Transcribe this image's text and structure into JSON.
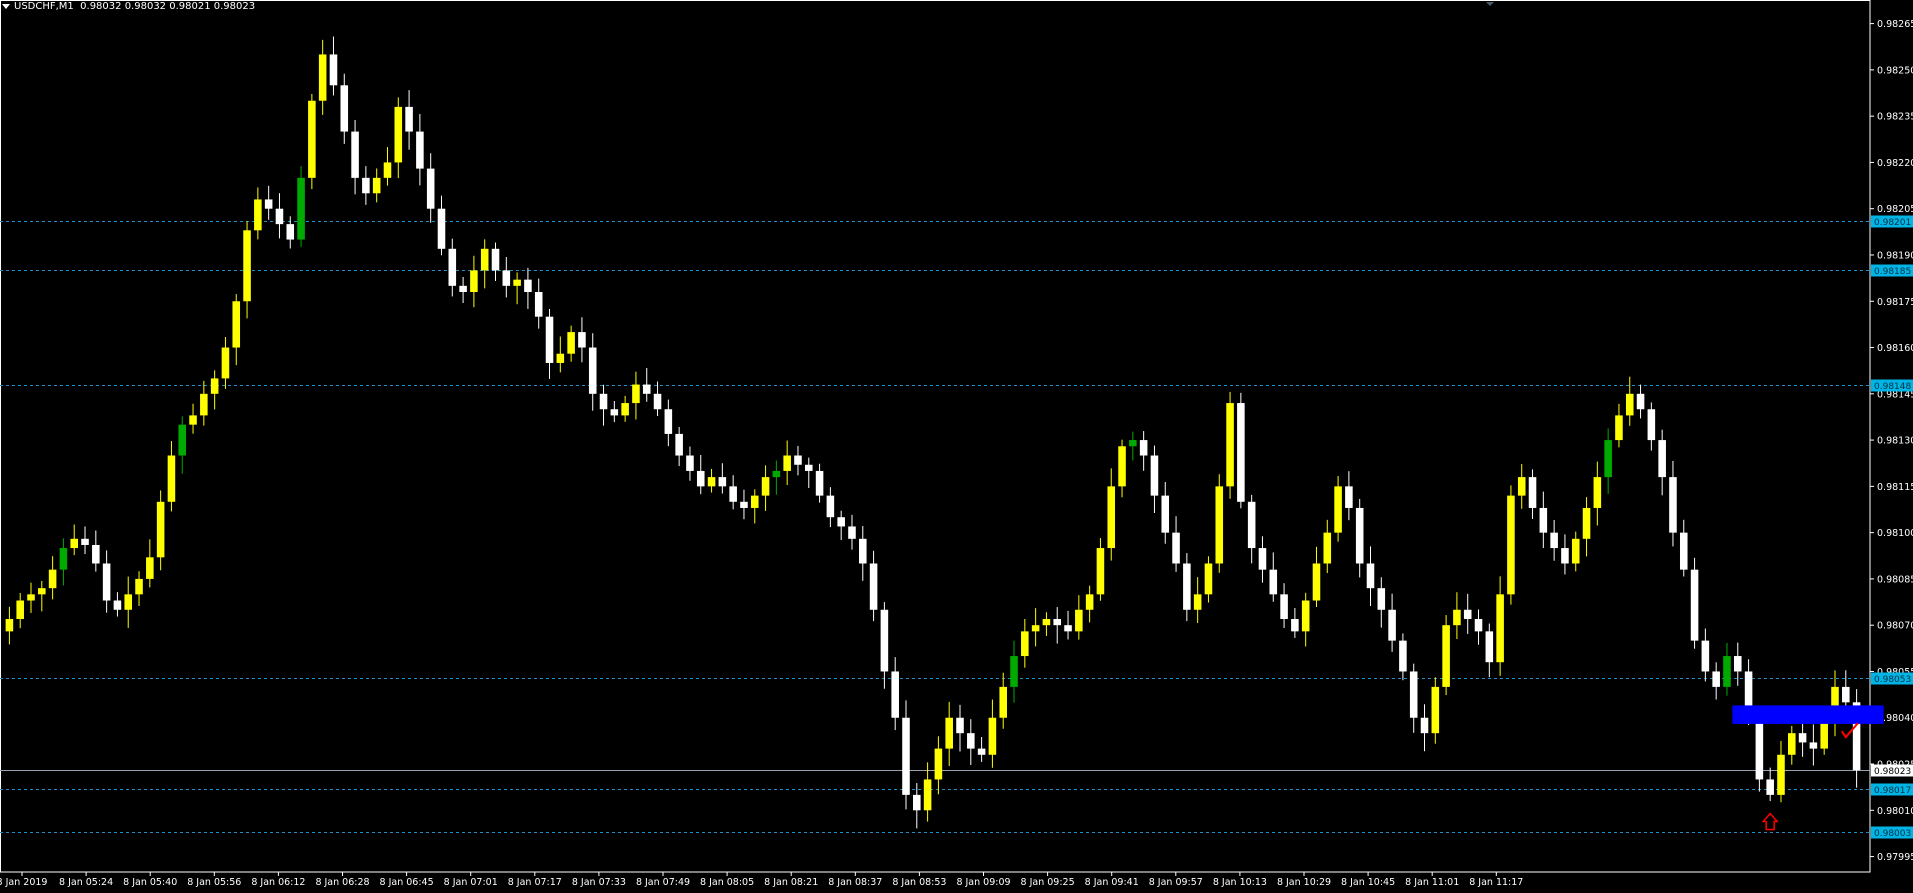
{
  "header": {
    "symbol": "USDCHF,M1",
    "ohlc": "0.98032 0.98032 0.98021 0.98023"
  },
  "colors": {
    "background": "#000000",
    "axis": "#ffffff",
    "bull_candle": "#ffff00",
    "bull_alt_candle": "#00aa00",
    "bear_candle": "#ffffff",
    "hline": "#1e90c8",
    "hline_label_bg": "#00b4e6",
    "zone": "#0000ff",
    "arrow": "#ff0000",
    "check": "#ff0000"
  },
  "chart_data": {
    "type": "candlestick",
    "ylim": [
      0.9799,
      0.98272
    ],
    "y_ticks": [
      "0.98265",
      "0.98250",
      "0.98235",
      "0.98220",
      "0.98205",
      "0.98190",
      "0.98175",
      "0.98160",
      "0.98145",
      "0.98130",
      "0.98115",
      "0.98100",
      "0.98085",
      "0.98070",
      "0.98055",
      "0.98040",
      "0.98025",
      "0.98010",
      "0.97995"
    ],
    "x_tick_labels": [
      "8 Jan 2019",
      "8 Jan 05:24",
      "8 Jan 05:40",
      "8 Jan 05:56",
      "8 Jan 06:12",
      "8 Jan 06:28",
      "8 Jan 06:45",
      "8 Jan 07:01",
      "8 Jan 07:17",
      "8 Jan 07:33",
      "8 Jan 07:49",
      "8 Jan 08:05",
      "8 Jan 08:21",
      "8 Jan 08:37",
      "8 Jan 08:53",
      "8 Jan 09:09",
      "8 Jan 09:25",
      "8 Jan 09:41",
      "8 Jan 09:57",
      "8 Jan 10:13",
      "8 Jan 10:29",
      "8 Jan 10:45",
      "8 Jan 11:01",
      "8 Jan 11:17"
    ],
    "closes": [
      0.98072,
      0.98078,
      0.9808,
      0.98082,
      0.98088,
      0.98095,
      0.98098,
      0.98096,
      0.9809,
      0.98078,
      0.98075,
      0.9808,
      0.98085,
      0.98092,
      0.9811,
      0.98125,
      0.98135,
      0.98138,
      0.98145,
      0.9815,
      0.9816,
      0.98175,
      0.98198,
      0.98208,
      0.98205,
      0.982,
      0.98195,
      0.98215,
      0.9824,
      0.98255,
      0.98245,
      0.9823,
      0.98215,
      0.9821,
      0.98215,
      0.9822,
      0.98238,
      0.9823,
      0.98218,
      0.98205,
      0.98192,
      0.9818,
      0.98178,
      0.98185,
      0.98192,
      0.98185,
      0.9818,
      0.98182,
      0.98178,
      0.9817,
      0.98155,
      0.98158,
      0.98165,
      0.9816,
      0.98145,
      0.9814,
      0.98138,
      0.98142,
      0.98148,
      0.98145,
      0.9814,
      0.98132,
      0.98125,
      0.9812,
      0.98115,
      0.98118,
      0.98115,
      0.9811,
      0.98108,
      0.98112,
      0.98118,
      0.9812,
      0.98125,
      0.98122,
      0.9812,
      0.98112,
      0.98105,
      0.98102,
      0.98098,
      0.9809,
      0.98075,
      0.98055,
      0.9804,
      0.98015,
      0.9801,
      0.9802,
      0.9803,
      0.9804,
      0.98035,
      0.9803,
      0.98028,
      0.9804,
      0.9805,
      0.9806,
      0.98068,
      0.9807,
      0.98072,
      0.9807,
      0.98068,
      0.98075,
      0.9808,
      0.98095,
      0.98115,
      0.98128,
      0.9813,
      0.98125,
      0.98112,
      0.981,
      0.9809,
      0.98075,
      0.9808,
      0.9809,
      0.98115,
      0.98142,
      0.9811,
      0.98095,
      0.98088,
      0.9808,
      0.98072,
      0.98068,
      0.98078,
      0.9809,
      0.981,
      0.98115,
      0.98108,
      0.9809,
      0.98082,
      0.98075,
      0.98065,
      0.98055,
      0.9804,
      0.98035,
      0.9805,
      0.9807,
      0.98075,
      0.98072,
      0.98068,
      0.98058,
      0.9808,
      0.98112,
      0.98118,
      0.98108,
      0.981,
      0.98095,
      0.9809,
      0.98098,
      0.98108,
      0.98118,
      0.9813,
      0.98138,
      0.98145,
      0.9814,
      0.9813,
      0.98118,
      0.981,
      0.98088,
      0.98065,
      0.98055,
      0.9805,
      0.9806,
      0.98055,
      0.9804,
      0.9802,
      0.98015,
      0.98028,
      0.98035,
      0.98032,
      0.9803,
      0.9804,
      0.9805,
      0.98045,
      0.98023
    ],
    "horizontal_levels": [
      {
        "price": 0.98201,
        "label": "0.98201",
        "style": "dashed"
      },
      {
        "price": 0.98185,
        "label": "0.98185",
        "style": "dashed"
      },
      {
        "price": 0.98148,
        "label": "0.98148",
        "style": "dashed"
      },
      {
        "price": 0.98053,
        "label": "0.98053",
        "style": "dashed"
      },
      {
        "price": 0.98017,
        "label": "0.98017",
        "style": "dashed"
      },
      {
        "price": 0.98003,
        "label": "0.98003",
        "style": "dashed"
      },
      {
        "price": 0.98023,
        "label": "0.98023",
        "style": "solid",
        "current": true
      }
    ],
    "zone": {
      "price_top": 0.98044,
      "price_bottom": 0.98038,
      "bar_start": 160,
      "bar_end": 173
    },
    "arrow_up": {
      "bar": 163,
      "price": 0.98007
    },
    "check_mark": {
      "bar": 170,
      "price": 0.98035
    }
  }
}
